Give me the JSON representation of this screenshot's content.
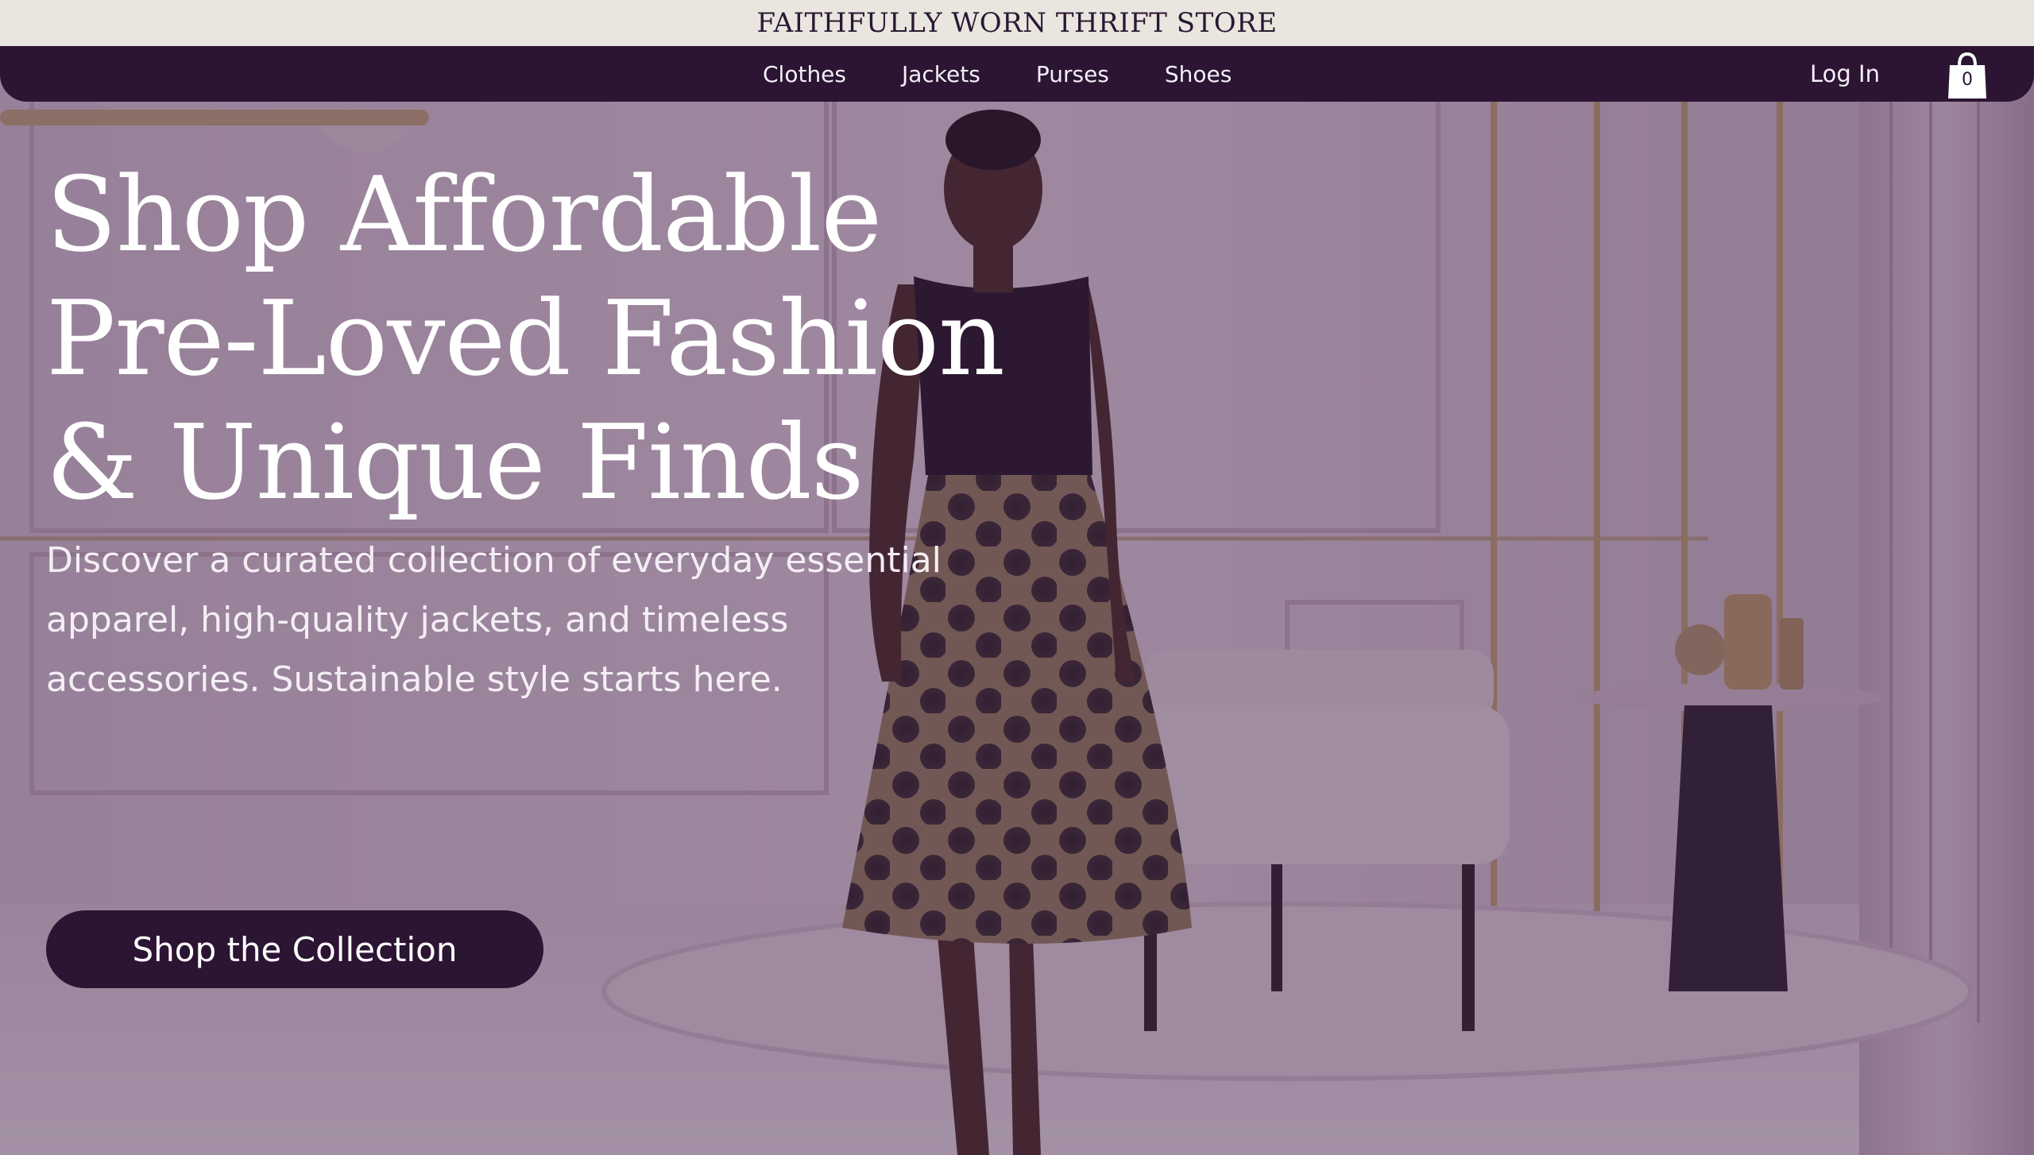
{
  "announcement": {
    "store_name": "FAITHFULLY WORN THRIFT STORE"
  },
  "nav": {
    "links": [
      {
        "label": "Clothes"
      },
      {
        "label": "Jackets"
      },
      {
        "label": "Purses"
      },
      {
        "label": "Shoes"
      }
    ],
    "login_label": "Log In",
    "cart_count": "0",
    "cart_icon": "shopping-bag-icon"
  },
  "hero": {
    "headline_lines": [
      "Shop Affordable",
      "Pre-Loved Fashion",
      "& Unique Finds"
    ],
    "subtext_lines": [
      "Discover a curated collection of everyday essential",
      "apparel, high-quality jackets, and timeless",
      "accessories. Sustainable style starts here."
    ],
    "cta_label": "Shop the Collection"
  },
  "colors": {
    "brand_dark": "#2b1533",
    "topbar_bg": "#e9e5df",
    "overlay": "#3c1c46",
    "text_light": "#ffffff"
  }
}
